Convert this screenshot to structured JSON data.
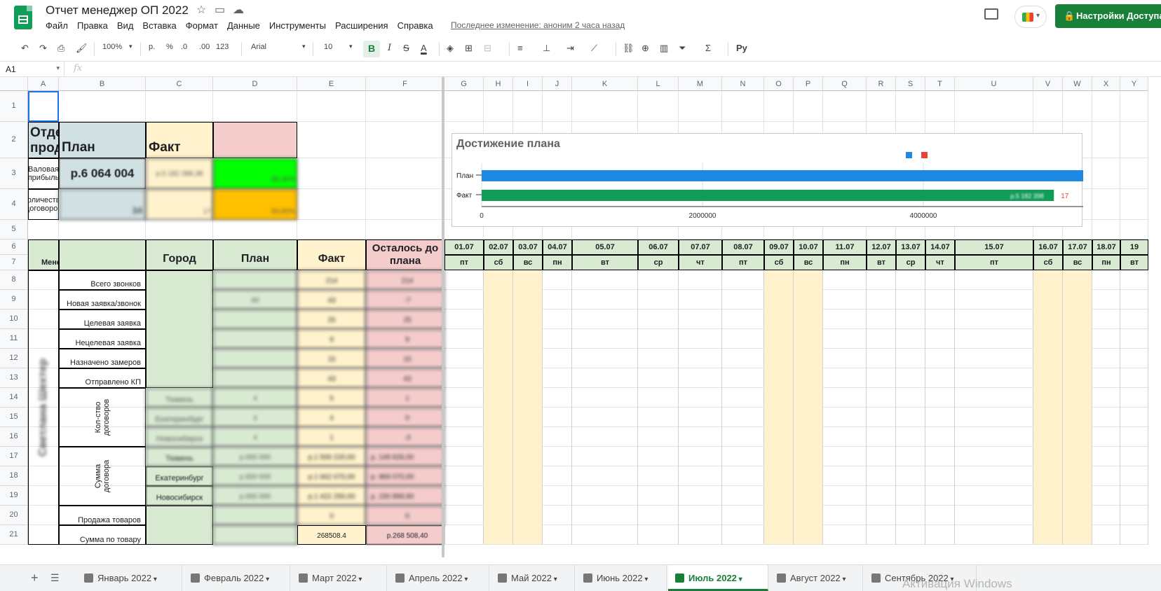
{
  "doc": {
    "title": "Отчет менеджер ОП 2022",
    "last_edit": "Последнее изменение: аноним 2 часа назад",
    "share_label": "Настройки Доступа"
  },
  "menu": [
    "Файл",
    "Правка",
    "Вид",
    "Вставка",
    "Формат",
    "Данные",
    "Инструменты",
    "Расширения",
    "Справка"
  ],
  "toolbar": {
    "zoom": "100%",
    "currency": "р.",
    "percent": "%",
    "dec_less": ".0",
    "dec_more": ".00",
    "format_123": "123",
    "font": "Arial",
    "font_size": "10",
    "bold": "B",
    "input_tools": "Py"
  },
  "formula": {
    "namebox": "A1",
    "fx": "fx"
  },
  "columns": [
    "A",
    "B",
    "C",
    "D",
    "E",
    "F",
    "G",
    "H",
    "I",
    "J",
    "K",
    "L",
    "M",
    "N",
    "O",
    "P",
    "Q",
    "R",
    "S",
    "T",
    "U",
    "V",
    "W",
    "X",
    "Y"
  ],
  "rows": [
    "1",
    "2",
    "3",
    "4",
    "5",
    "6",
    "7",
    "8",
    "9",
    "10",
    "11",
    "12",
    "13",
    "14",
    "15",
    "16",
    "17",
    "18",
    "19",
    "20",
    "21"
  ],
  "summary": {
    "dept": "Отдел продаж",
    "plan": "План",
    "fact": "Факт",
    "gross_profit": "Валовая прибыль",
    "gross_plan": "р.6 064 004",
    "gross_fact": "р.5 182 398,38",
    "gross_pct": "85,46%",
    "contracts": "Количество договоров",
    "contracts_plan": "34",
    "contracts_fact": "17",
    "contracts_pct": "50,00%"
  },
  "chart": {
    "title": "Достижение плана",
    "bar_labels": [
      "План",
      "Факт"
    ],
    "fact_inner": "р.5 182 398",
    "fact_side": "17",
    "ticks": [
      "0",
      "2000000",
      "4000000"
    ]
  },
  "chart_data": {
    "type": "bar",
    "title": "Достижение плана",
    "categories": [
      "План",
      "Факт"
    ],
    "series": [
      {
        "values": [
          6064004,
          0
        ],
        "color": "#1e88e5"
      },
      {
        "values": [
          0,
          5182398
        ],
        "color": "#0f9d58"
      }
    ],
    "xlim": [
      0,
      6000000
    ],
    "legend": "top"
  },
  "table": {
    "h_manager": "Менеджер",
    "h_city": "Город",
    "h_plan": "План",
    "h_fact": "Факт",
    "h_left": "Осталось до плана",
    "manager_name": "Светлана Шехтер",
    "metrics": [
      "Всего звонков",
      "Новая заявка/звонок",
      "Целевая заявка",
      "Нецелевая заявка",
      "Назначено замеров",
      "Отправлено КП"
    ],
    "group_count": "Кол-ство договоров",
    "group_sum": "Сумма договора",
    "cities": [
      "Тюмень",
      "Екатеринбург",
      "Новосибирск"
    ],
    "sales": "Продажа товаров",
    "sum_goods": "Сумма по товару",
    "plan_vals": [
      "",
      "60",
      "",
      "",
      "",
      "",
      "4",
      "4",
      "4",
      "р.650 000",
      "р.650 000",
      "р.650 000",
      "",
      ""
    ],
    "fact_vals": [
      "214",
      "43",
      "25",
      "9",
      "15",
      "43",
      "5",
      "4",
      "1",
      "р.1 500 220,00",
      "р.1 662 070,00",
      "р.1 422 250,00",
      "0",
      "268508.4"
    ],
    "left_vals": [
      "214",
      "-7",
      "25",
      "9",
      "15",
      "43",
      "1",
      "0",
      "-3",
      "р. 149 626,00",
      "р. 969 070,00",
      "р. 150 899,90",
      "0",
      "р.268 508,40"
    ]
  },
  "dates": [
    "01.07",
    "02.07",
    "03.07",
    "04.07",
    "05.07",
    "06.07",
    "07.07",
    "08.07",
    "09.07",
    "10.07",
    "11.07",
    "12.07",
    "13.07",
    "14.07",
    "15.07",
    "16.07",
    "17.07",
    "18.07",
    "19"
  ],
  "weekdays": [
    "пт",
    "сб",
    "вс",
    "пн",
    "вт",
    "ср",
    "чт",
    "пт",
    "сб",
    "вс",
    "пн",
    "вт",
    "ср",
    "чт",
    "пт",
    "сб",
    "вс",
    "пн",
    "вт"
  ],
  "tabs": [
    {
      "label": "Январь  2022",
      "active": false
    },
    {
      "label": "Февраль  2022",
      "active": false
    },
    {
      "label": "Март  2022",
      "active": false
    },
    {
      "label": "Апрель 2022",
      "active": false
    },
    {
      "label": "Май 2022",
      "active": false
    },
    {
      "label": "Июнь 2022",
      "active": false
    },
    {
      "label": "Июль 2022",
      "active": true
    },
    {
      "label": "Август 2022",
      "active": false
    },
    {
      "label": "Сентябрь 2022",
      "active": false
    }
  ],
  "watermark": "Активация Windows",
  "colors": {
    "header_green": "#d9ead3",
    "plan_blue": "#d0e0e3",
    "fact_yellow": "#fff2cc",
    "left_red": "#f4cccc",
    "good": "#00ff00",
    "warn": "#ffc000",
    "weekend": "#fff2cc",
    "accent": "#188038"
  }
}
